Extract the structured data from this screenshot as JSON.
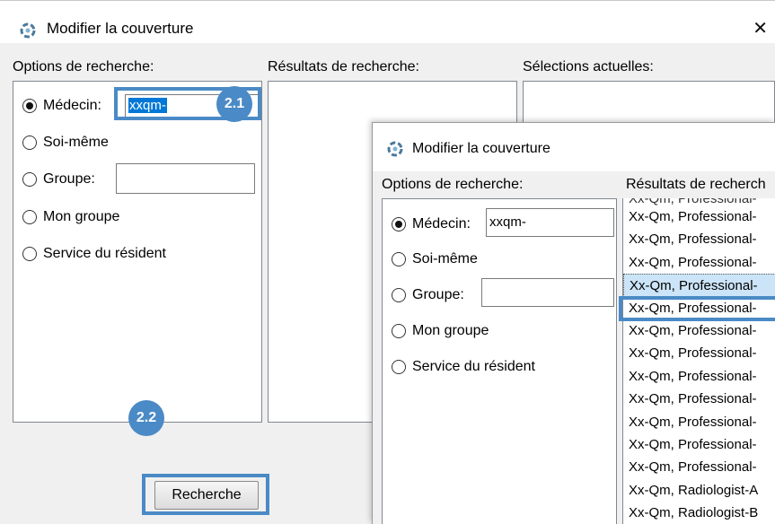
{
  "back_window": {
    "title": "Modifier la couverture",
    "close_glyph": "✕",
    "labels": {
      "search_options": "Options de recherche:",
      "search_results": "Résultats de recherche:",
      "current_selections": "Sélections actuelles:"
    },
    "radios": {
      "doctor": "Médecin:",
      "self": "Soi-même",
      "group": "Groupe:",
      "my_group": "Mon groupe",
      "resident_service": "Service du résident"
    },
    "doctor_input_value": "xxqm-",
    "group_input_value": "",
    "search_button": "Recherche",
    "callouts": {
      "input_badge": "2.1",
      "button_badge": "2.2"
    }
  },
  "front_window": {
    "title": "Modifier la couverture",
    "labels": {
      "search_options": "Options de recherche:",
      "search_results": "Résultats de recherch"
    },
    "radios": {
      "doctor": "Médecin:",
      "self": "Soi-même",
      "group": "Groupe:",
      "my_group": "Mon groupe",
      "resident_service": "Service du résident"
    },
    "doctor_input_value": "xxqm-",
    "group_input_value": "",
    "results": [
      "Xx-Qm, Professional-",
      "Xx-Qm, Professional-",
      "Xx-Qm, Professional-",
      "Xx-Qm, Professional-",
      "Xx-Qm, Professional-",
      "Xx-Qm, Professional-",
      "Xx-Qm, Professional-",
      "Xx-Qm, Professional-",
      "Xx-Qm, Professional-",
      "Xx-Qm, Professional-",
      "Xx-Qm, Professional-",
      "Xx-Qm, Professional-",
      "Xx-Qm, Radiologist-A",
      "Xx-Qm, Radiologist-B"
    ],
    "top_cut_item": "Xx-Qm, Professional-",
    "selected_index": 3
  },
  "colors": {
    "accent": "#4a8ac6",
    "selection": "#cce4f7"
  },
  "icons": {
    "app": "refresh-gear-icon",
    "close": "close-icon"
  }
}
